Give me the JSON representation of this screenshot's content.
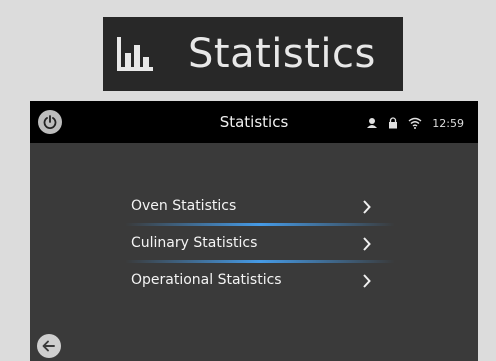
{
  "banner": {
    "icon": "bar-chart-icon",
    "title": "Statistics"
  },
  "topbar": {
    "power_icon": "power-icon",
    "title": "Statistics",
    "status_icons": [
      "user-icon",
      "lock-icon",
      "wifi-icon"
    ],
    "time": "12:59"
  },
  "menu": {
    "items": [
      {
        "label": "Oven Statistics",
        "icon": "chevron-right-icon"
      },
      {
        "label": "Culinary Statistics",
        "icon": "chevron-right-icon"
      },
      {
        "label": "Operational Statistics",
        "icon": "chevron-right-icon"
      }
    ]
  },
  "footer": {
    "back_icon": "arrow-left-icon"
  },
  "colors": {
    "screen_bg": "#3a3a3a",
    "topbar_bg": "#000000",
    "accent_glow": "#46a0f0",
    "banner_bg": "#282828"
  }
}
